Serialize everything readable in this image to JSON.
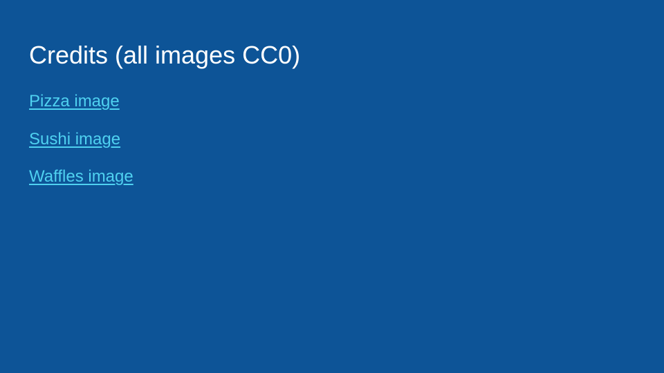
{
  "slide": {
    "title": "Credits (all images CC0)",
    "links": [
      {
        "label": "Pizza image"
      },
      {
        "label": "Sushi image"
      },
      {
        "label": "Waffles image"
      }
    ]
  },
  "colors": {
    "background": "#0d5497",
    "title_text": "#ffffff",
    "link": "#4fd1f0"
  }
}
